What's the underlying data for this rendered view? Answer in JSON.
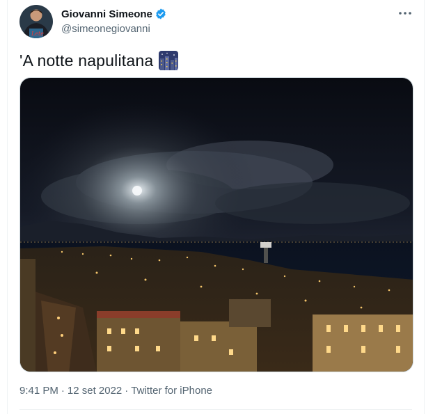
{
  "author": {
    "name": "Giovanni Simeone",
    "handle": "@simeonegiovanni",
    "verified": true,
    "avatar_text": "Lete"
  },
  "tweet": {
    "text": "'A notte napulitana",
    "emoji": "night-city-emoji"
  },
  "meta": {
    "time": "9:41 PM",
    "separator1": "·",
    "date": "12 set 2022",
    "separator2": "·",
    "source": "Twitter for iPhone"
  },
  "colors": {
    "verified_blue": "#1d9bf0",
    "secondary_text": "#536471",
    "primary_text": "#0f1419"
  }
}
